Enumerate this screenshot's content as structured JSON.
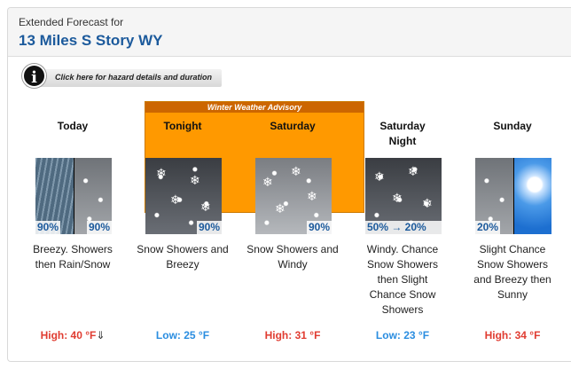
{
  "header": {
    "subtitle": "Extended Forecast for",
    "location": "13 Miles S Story WY"
  },
  "hazard": {
    "icon": "info-icon",
    "link_text": "Click here for hazard details and duration"
  },
  "advisory": {
    "label": "Winter Weather Advisory",
    "color": "#ff9900"
  },
  "periods": [
    {
      "name": "Today",
      "icon": "rain-snow-icon",
      "pop_left": "90%",
      "pop_right": "90%",
      "description": "Breezy. Showers then Rain/Snow",
      "temp_label": "High: 40 °F",
      "trend": "⇓",
      "temp_type": "high"
    },
    {
      "name": "Tonight",
      "icon": "snow-showers-icon",
      "pop_right": "90%",
      "description": "Snow Showers and Breezy",
      "temp_label": "Low: 25 °F",
      "temp_type": "low"
    },
    {
      "name": "Saturday",
      "icon": "snow-showers-icon",
      "pop_right": "90%",
      "description": "Snow Showers and Windy",
      "temp_label": "High: 31 °F",
      "temp_type": "high"
    },
    {
      "name": "Saturday Night",
      "icon": "snow-showers-icon",
      "pop_range": "50% → 20%",
      "description": "Windy. Chance Snow Showers then Slight Chance Snow Showers",
      "temp_label": "Low: 23 °F",
      "temp_type": "low"
    },
    {
      "name": "Sunday",
      "icon": "snow-then-sunny-icon",
      "pop_left": "20%",
      "description": "Slight Chance Snow Showers and Breezy then Sunny",
      "temp_label": "High: 34 °F",
      "temp_type": "high"
    }
  ],
  "colors": {
    "title_blue": "#1c5a9c",
    "high_red": "#e03c31",
    "low_blue": "#2a8de0"
  }
}
